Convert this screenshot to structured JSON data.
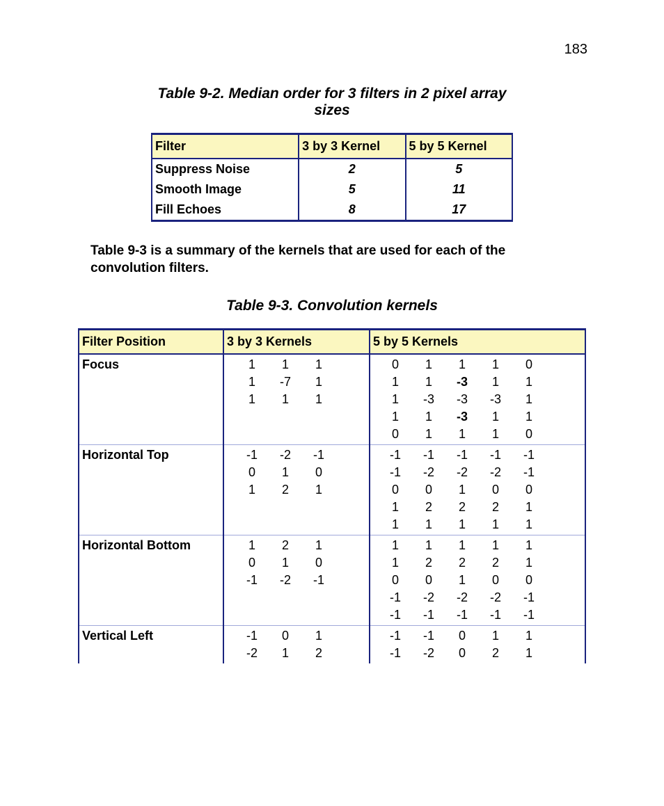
{
  "page_number": "183",
  "t92_caption": "Table 9-2. Median order for 3  filters in 2 pixel array sizes",
  "t92_headers": [
    "Filter",
    "3 by 3 Kernel",
    "5 by 5 Kernel"
  ],
  "t92_rows": [
    {
      "label": "Suppress Noise",
      "k3": "2",
      "k5": "5"
    },
    {
      "label": "Smooth Image",
      "k3": "5",
      "k5": "11"
    },
    {
      "label": "Fill Echoes",
      "k3": "8",
      "k5": "17"
    }
  ],
  "intertext": "Table 9-3 is a summary of the kernels that are used for each of the convolution filters.",
  "t93_caption": "Table 9-3. Convolution kernels",
  "t93_headers": [
    "Filter Position",
    "3 by 3 Kernels",
    "5 by 5 Kernels"
  ],
  "t93_rows": [
    {
      "label": "Focus",
      "k3": [
        [
          "1",
          "1",
          "1"
        ],
        [
          "1",
          "-7",
          "1"
        ],
        [
          "1",
          "1",
          "1"
        ]
      ],
      "k5": [
        [
          "0",
          "1",
          "1",
          "1",
          "0"
        ],
        [
          "1",
          "1",
          "-3",
          "1",
          "1"
        ],
        [
          "1",
          "-3",
          "-3",
          "-3",
          "1"
        ],
        [
          "1",
          "1",
          "-3",
          "1",
          "1"
        ],
        [
          "0",
          "1",
          "1",
          "1",
          "0"
        ]
      ],
      "k5_bold": [
        [
          0,
          0,
          0,
          0,
          0
        ],
        [
          0,
          0,
          1,
          0,
          0
        ],
        [
          0,
          0,
          0,
          0,
          0
        ],
        [
          0,
          0,
          1,
          0,
          0
        ],
        [
          0,
          0,
          0,
          0,
          0
        ]
      ]
    },
    {
      "label": "Horizontal Top",
      "k3": [
        [
          "-1",
          "-2",
          "-1"
        ],
        [
          "0",
          "1",
          "0"
        ],
        [
          "1",
          "2",
          "1"
        ]
      ],
      "k5": [
        [
          "-1",
          "-1",
          "-1",
          "-1",
          "-1"
        ],
        [
          "-1",
          "-2",
          "-2",
          "-2",
          "-1"
        ],
        [
          "0",
          "0",
          "1",
          "0",
          "0"
        ],
        [
          "1",
          "2",
          "2",
          "2",
          "1"
        ],
        [
          "1",
          "1",
          "1",
          "1",
          "1"
        ]
      ]
    },
    {
      "label": "Horizontal Bottom",
      "k3": [
        [
          "1",
          "2",
          "1"
        ],
        [
          "0",
          "1",
          "0"
        ],
        [
          "-1",
          "-2",
          "-1"
        ]
      ],
      "k5": [
        [
          "1",
          "1",
          "1",
          "1",
          "1"
        ],
        [
          "1",
          "2",
          "2",
          "2",
          "1"
        ],
        [
          "0",
          "0",
          "1",
          "0",
          "0"
        ],
        [
          "-1",
          "-2",
          "-2",
          "-2",
          "-1"
        ],
        [
          "-1",
          "-1",
          "-1",
          "-1",
          "-1"
        ]
      ]
    },
    {
      "label": "Vertical Left",
      "k3": [
        [
          "-1",
          "0",
          "1"
        ],
        [
          "-2",
          "1",
          "2"
        ]
      ],
      "k5": [
        [
          "-1",
          "-1",
          "0",
          "1",
          "1"
        ],
        [
          "-1",
          "-2",
          "0",
          "2",
          "1"
        ]
      ]
    }
  ]
}
